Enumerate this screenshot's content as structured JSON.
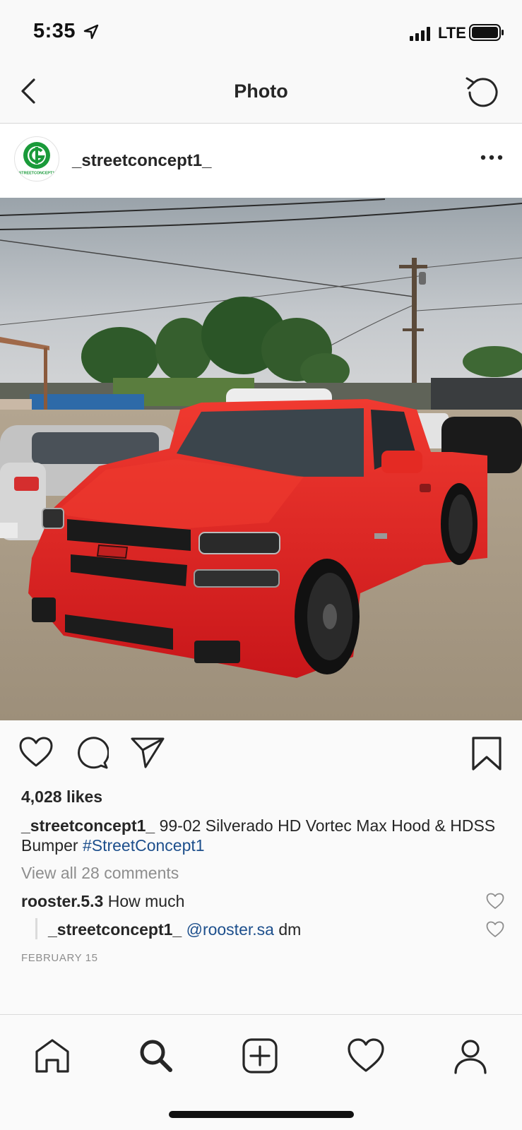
{
  "status_bar": {
    "time": "5:35",
    "carrier": "LTE",
    "icons": [
      "location-arrow-icon",
      "signal-bars-icon",
      "battery-icon"
    ]
  },
  "header": {
    "title": "Photo",
    "back_icon": "chevron-left-icon",
    "refresh_icon": "refresh-icon"
  },
  "post": {
    "username": "_streetconcept1_",
    "avatar_text": "STREETCONCEPT1",
    "avatar_color": "#1a9a3a",
    "more_icon": "ellipsis-icon",
    "photo_subject": "red pickup truck",
    "likes": "4,028 likes",
    "caption": {
      "username": "_streetconcept1_",
      "text": " 99-02 Silverado HD Vortec Max Hood & HDSS Bumper ",
      "hashtag": "#StreetConcept1"
    },
    "view_comments": "View all 28 comments",
    "comments": [
      {
        "username": "rooster.5.3",
        "text": " How much"
      }
    ],
    "replies": [
      {
        "username": "_streetconcept1_",
        "mention": " @rooster.sa",
        "text": " dm"
      }
    ],
    "date": "FEBRUARY 15"
  },
  "actions": {
    "icons": [
      "heart-icon",
      "comment-icon",
      "share-icon",
      "bookmark-icon"
    ]
  },
  "tab_bar": {
    "icons": [
      "home-icon",
      "search-icon",
      "new-post-icon",
      "activity-heart-icon",
      "profile-icon"
    ]
  },
  "colors": {
    "link": "#1d4f8c",
    "muted": "#8e8e8e",
    "text": "#262626",
    "truck_red": "#e5231e"
  }
}
